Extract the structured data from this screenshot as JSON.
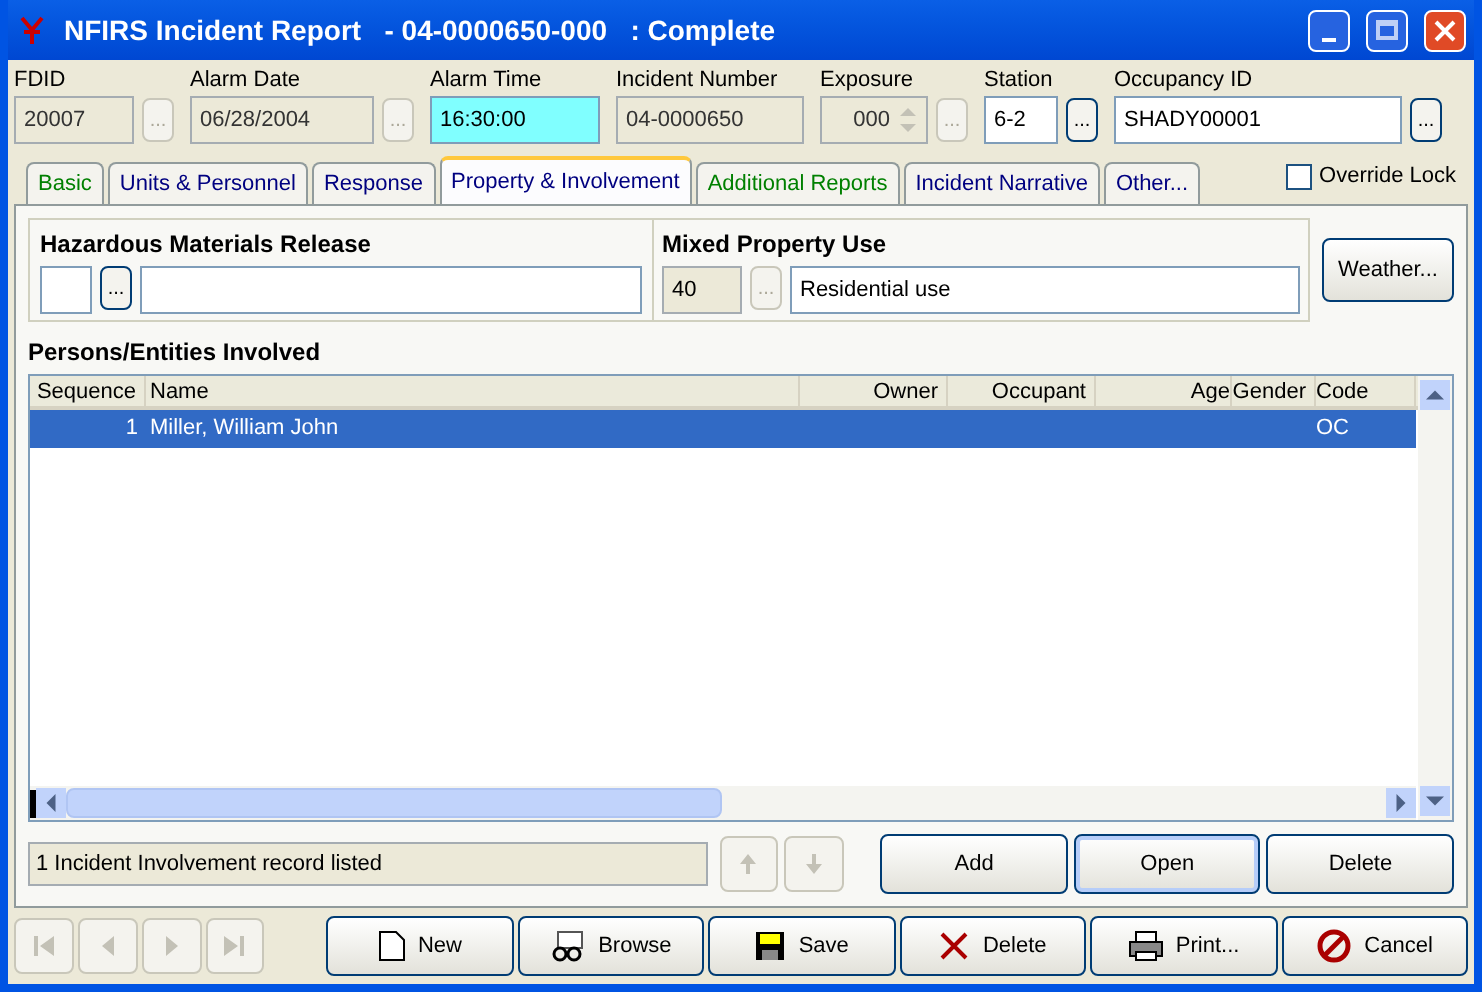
{
  "window": {
    "title": "NFIRS Incident Report   - 04-0000650-000   : Complete"
  },
  "header_fields": [
    {
      "label": "FDID",
      "value": "20007",
      "disabled": true,
      "focused": false,
      "spinner": false,
      "browse": {
        "label": "...",
        "disabled": true
      }
    },
    {
      "label": "Alarm Date",
      "value": "06/28/2004",
      "disabled": true,
      "focused": false,
      "spinner": false,
      "browse": {
        "label": "...",
        "disabled": true
      }
    },
    {
      "label": "Alarm Time",
      "value": "16:30:00",
      "disabled": false,
      "focused": true,
      "spinner": false
    },
    {
      "label": "Incident Number",
      "value": "04-0000650",
      "disabled": true,
      "focused": false,
      "spinner": false
    },
    {
      "label": "Exposure",
      "value": "000",
      "disabled": true,
      "focused": false,
      "spinner": true,
      "browse": {
        "label": "...",
        "disabled": true
      }
    },
    {
      "label": "Station",
      "value": "6-2",
      "disabled": false,
      "focused": false,
      "spinner": false,
      "browse": {
        "label": "...",
        "disabled": false
      }
    },
    {
      "label": "Occupancy ID",
      "value": "SHADY00001",
      "disabled": false,
      "focused": false,
      "spinner": false,
      "browse": {
        "label": "...",
        "disabled": false
      }
    }
  ],
  "tabs": [
    {
      "label": "Basic",
      "selected": false,
      "color": "#008000"
    },
    {
      "label": "Units & Personnel",
      "selected": false,
      "color": "#000080"
    },
    {
      "label": "Response",
      "selected": false,
      "color": "#000080"
    },
    {
      "label": "Property & Involvement",
      "selected": true,
      "color": "#000080"
    },
    {
      "label": "Additional Reports",
      "selected": false,
      "color": "#008000"
    },
    {
      "label": "Incident Narrative",
      "selected": false,
      "color": "#000080"
    },
    {
      "label": "Other...",
      "selected": false,
      "color": "#000080"
    }
  ],
  "override_lock": {
    "label": "Override Lock",
    "checked": false
  },
  "hazardous_materials": {
    "title": "Hazardous Materials Release",
    "browse": {
      "label": "...",
      "disabled": false
    }
  },
  "mixed_property_use": {
    "title": "Mixed Property Use",
    "code": "40",
    "description": "Residential use",
    "browse": {
      "label": "...",
      "disabled": true
    }
  },
  "weather_button": "Weather...",
  "persons": {
    "title": "Persons/Entities Involved",
    "columns": [
      "Sequence",
      "Name",
      "Owner",
      "Occupant",
      "Age",
      "Gender",
      "Code"
    ],
    "rows": [
      {
        "selected": true,
        "cells": [
          "1",
          "Miller, William John",
          "",
          "",
          "",
          "",
          "OC"
        ]
      }
    ]
  },
  "status": "1 Incident Involvement record listed",
  "list_buttons": [
    "Add",
    "Open",
    "Delete"
  ],
  "footer_buttons": [
    {
      "kind": "new",
      "label": "New"
    },
    {
      "kind": "browse",
      "label": "Browse"
    },
    {
      "kind": "save",
      "label": "Save"
    },
    {
      "kind": "delete",
      "label": "Delete"
    },
    {
      "kind": "print",
      "label": "Print..."
    },
    {
      "kind": "cancel",
      "label": "Cancel"
    }
  ]
}
